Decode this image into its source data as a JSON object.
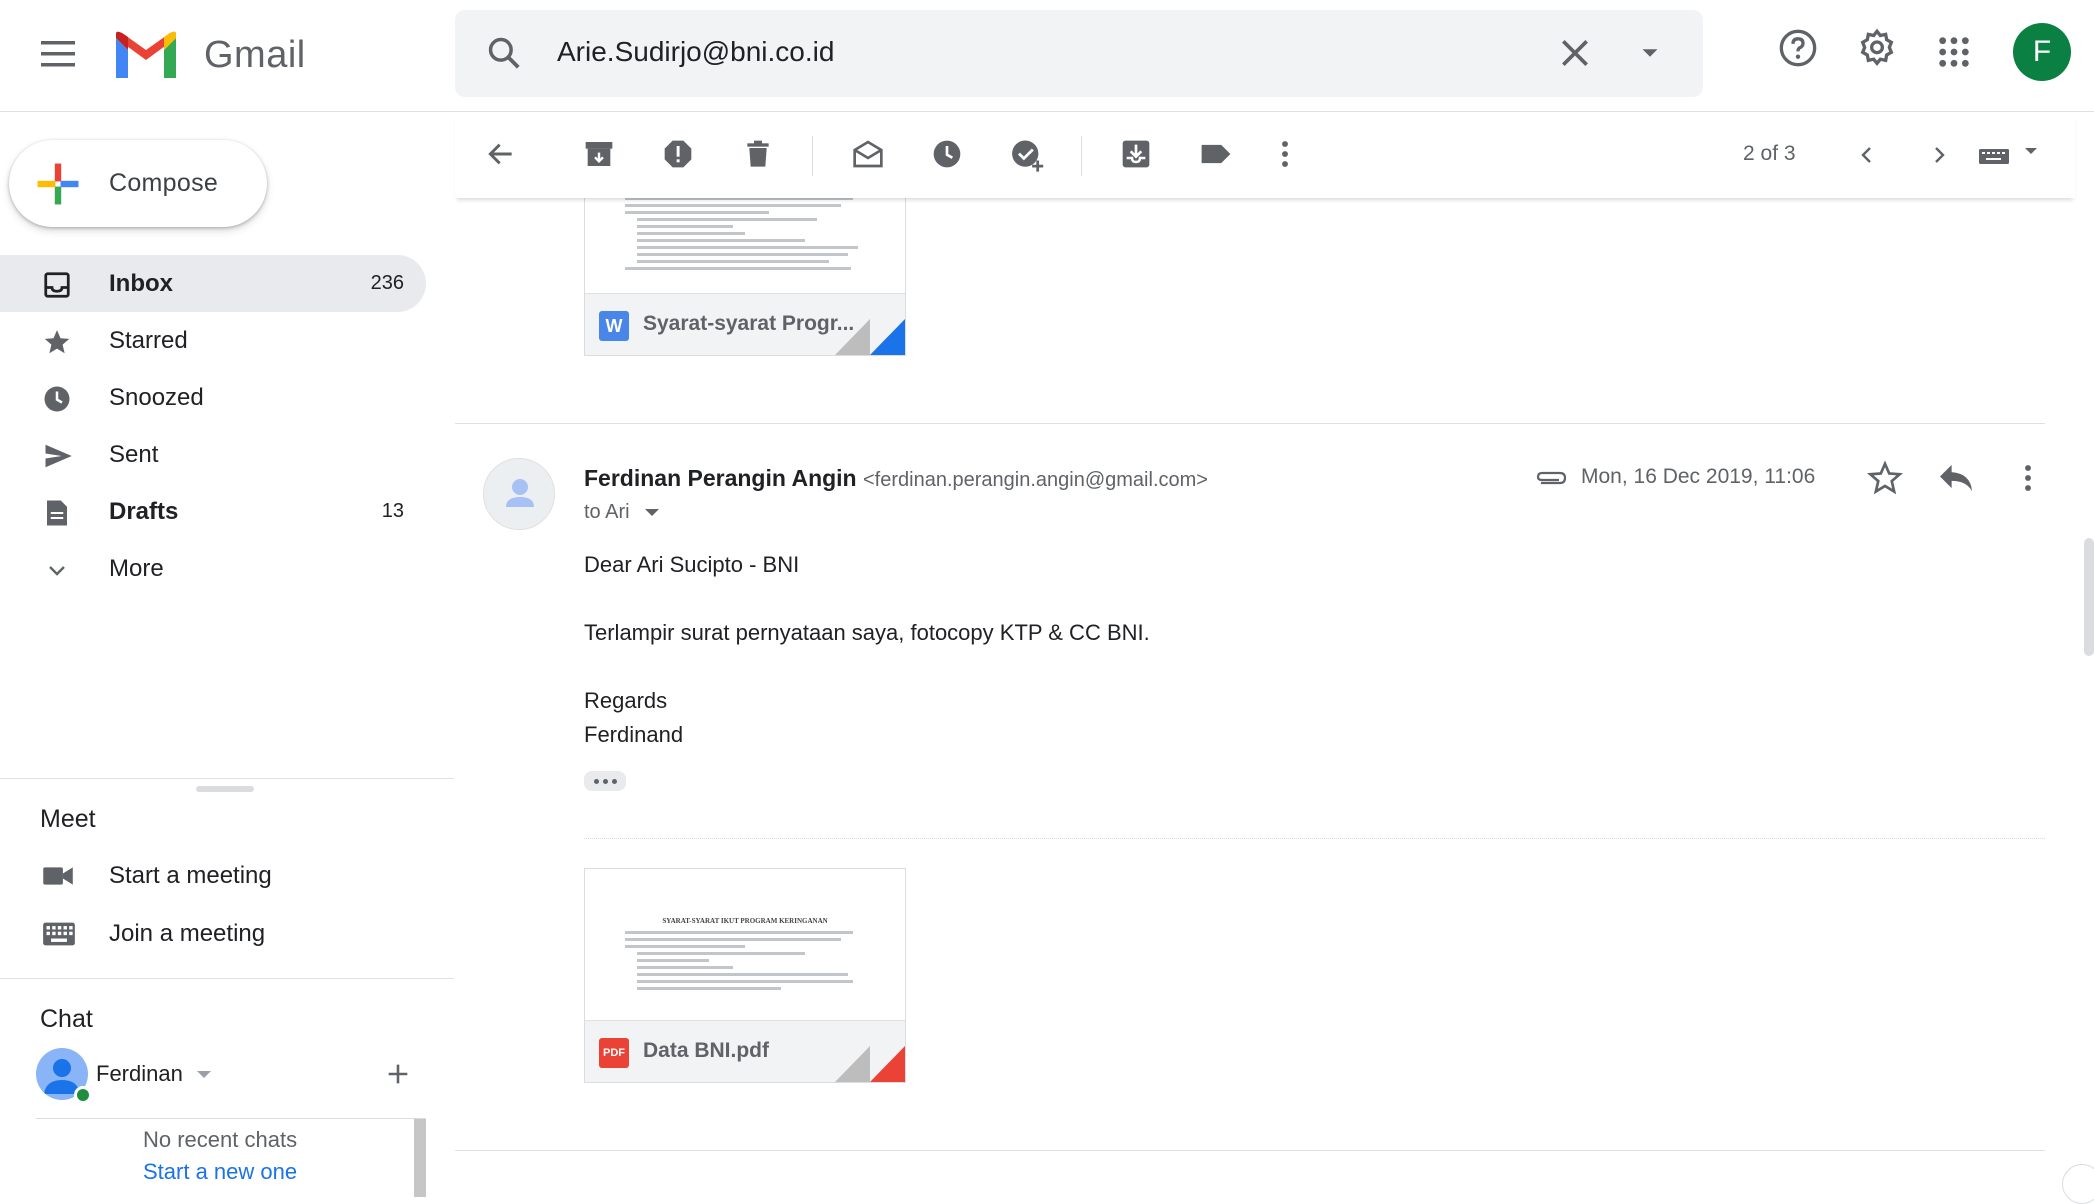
{
  "header": {
    "app_name": "Gmail",
    "search_value": "Arie.Sudirjo@bni.co.id",
    "avatar_letter": "F",
    "avatar_color": "#0b8043"
  },
  "sidebar": {
    "compose_label": "Compose",
    "items": [
      {
        "label": "Inbox",
        "count": "236",
        "icon": "inbox-icon",
        "bold": true,
        "active": true
      },
      {
        "label": "Starred",
        "count": "",
        "icon": "star-icon"
      },
      {
        "label": "Snoozed",
        "count": "",
        "icon": "clock-icon"
      },
      {
        "label": "Sent",
        "count": "",
        "icon": "send-icon"
      },
      {
        "label": "Drafts",
        "count": "13",
        "icon": "draft-icon",
        "bold": true
      },
      {
        "label": "More",
        "count": "",
        "icon": "chevron-down-icon"
      }
    ],
    "meet": {
      "title": "Meet",
      "start": "Start a meeting",
      "join": "Join a meeting"
    },
    "chat": {
      "title": "Chat",
      "user": "Ferdinan",
      "no_recent": "No recent chats",
      "start_new": "Start a new one"
    }
  },
  "toolbar": {
    "pager": "2 of 3"
  },
  "thread": {
    "first_attachment": {
      "name": "Syarat-syarat Progr...",
      "type": "W",
      "type_color": "#4a86e8"
    },
    "message": {
      "sender_name": "Ferdinan Perangin Angin",
      "sender_email": "<ferdinan.perangin.angin@gmail.com>",
      "to": "to Ari",
      "date": "Mon, 16 Dec 2019, 11:06",
      "body": [
        "Dear Ari Sucipto - BNI",
        "Terlampir surat pernyataan saya, fotocopy KTP & CC BNI.",
        "Regards",
        "Ferdinand"
      ],
      "attachment": {
        "name": "Data BNI.pdf",
        "type": "PDF",
        "type_color": "#ea4335",
        "preview_title": "SYARAT-SYARAT IKUT PROGRAM KERINGANAN"
      }
    }
  }
}
